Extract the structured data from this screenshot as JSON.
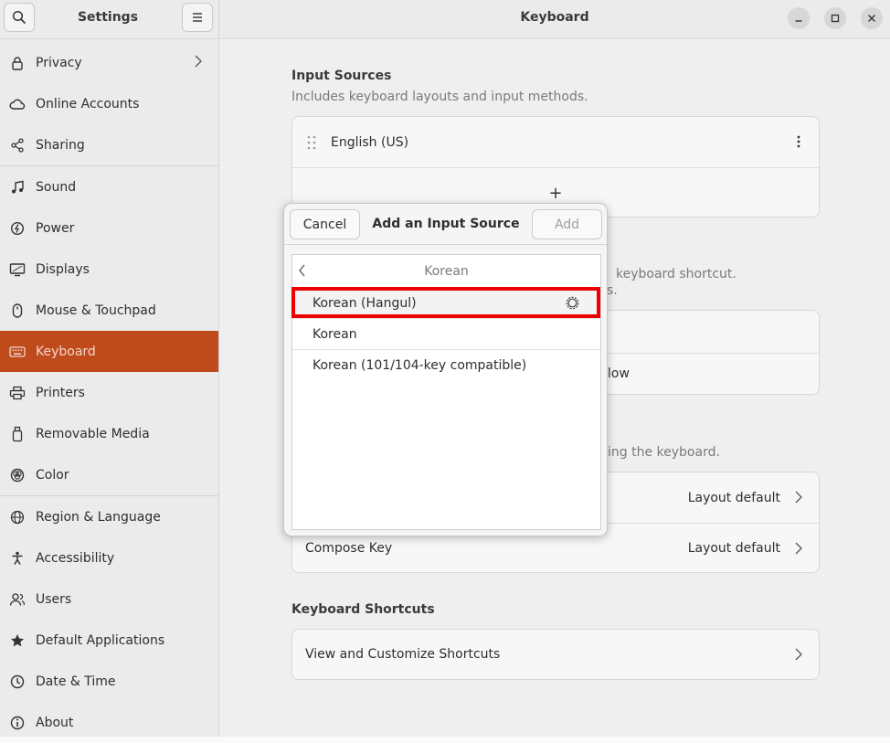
{
  "sidebar": {
    "title": "Settings",
    "items": [
      {
        "label": "Privacy",
        "icon": "lock-icon",
        "chevron": true
      },
      {
        "label": "Online Accounts",
        "icon": "cloud-icon"
      },
      {
        "label": "Sharing",
        "icon": "share-icon"
      },
      {
        "label": "Sound",
        "icon": "music-note-icon"
      },
      {
        "label": "Power",
        "icon": "power-icon"
      },
      {
        "label": "Displays",
        "icon": "display-icon"
      },
      {
        "label": "Mouse & Touchpad",
        "icon": "mouse-icon"
      },
      {
        "label": "Keyboard",
        "icon": "keyboard-icon",
        "active": true
      },
      {
        "label": "Printers",
        "icon": "printer-icon"
      },
      {
        "label": "Removable Media",
        "icon": "usb-icon"
      },
      {
        "label": "Color",
        "icon": "color-icon"
      },
      {
        "label": "Region & Language",
        "icon": "globe-icon"
      },
      {
        "label": "Accessibility",
        "icon": "accessibility-icon"
      },
      {
        "label": "Users",
        "icon": "users-icon"
      },
      {
        "label": "Default Applications",
        "icon": "star-icon"
      },
      {
        "label": "Date & Time",
        "icon": "clock-icon"
      },
      {
        "label": "About",
        "icon": "info-icon"
      }
    ]
  },
  "header": {
    "title": "Keyboard"
  },
  "input_sources": {
    "title": "Input Sources",
    "subtitle": "Includes keyboard layouts and input methods.",
    "items": [
      {
        "label": "English (US)"
      }
    ],
    "add_glyph": "+"
  },
  "switching": {
    "subtitle_fragment": "keyboard shortcut.",
    "subtitle_fragment2": "s.",
    "row_fragment": "low"
  },
  "special_entry": {
    "subtitle_fragment": "ing the keyboard.",
    "rows": [
      {
        "label": "",
        "value": "Layout default"
      },
      {
        "label": "Compose Key",
        "value": "Layout default"
      }
    ]
  },
  "shortcuts": {
    "title": "Keyboard Shortcuts",
    "row_label": "View and Customize Shortcuts"
  },
  "dialog": {
    "cancel_label": "Cancel",
    "title": "Add an Input Source",
    "add_label": "Add",
    "search_text": "Korean",
    "results": [
      {
        "label": "Korean (Hangul)",
        "has_settings": true,
        "selected": true
      },
      {
        "label": "Korean"
      },
      {
        "label": "Korean (101/104-key compatible)"
      }
    ]
  },
  "colors": {
    "accent": "#bf4a1c",
    "highlight": "#ee0000"
  }
}
